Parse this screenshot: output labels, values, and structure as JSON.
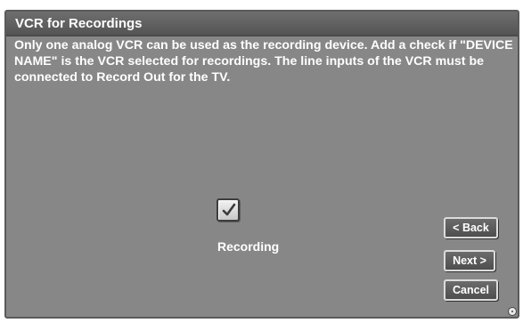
{
  "dialog": {
    "title": "VCR for Recordings",
    "message": "Only one analog VCR can be used as the recording device.  Add a check if \"DEVICE NAME\" is the VCR selected for recordings.  The line inputs of the VCR must be connected to Record Out for the TV."
  },
  "checkbox": {
    "label": "Recording",
    "checked": true
  },
  "buttons": {
    "back": "< Back",
    "next": "Next >",
    "cancel": "Cancel"
  },
  "icons": {
    "checkbox": "checkmark-icon",
    "corner": "info-icon"
  }
}
